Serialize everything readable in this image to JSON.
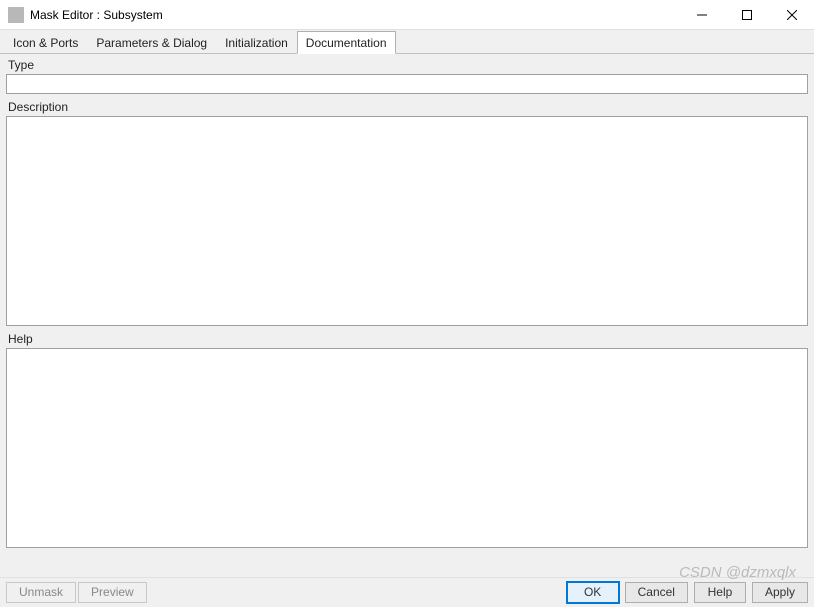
{
  "window": {
    "title": "Mask Editor : Subsystem"
  },
  "tabs": {
    "icon_ports": "Icon & Ports",
    "params_dialog": "Parameters & Dialog",
    "initialization": "Initialization",
    "documentation": "Documentation"
  },
  "fields": {
    "type_label": "Type",
    "type_value": "",
    "description_label": "Description",
    "description_value": "",
    "help_label": "Help",
    "help_value": ""
  },
  "buttons": {
    "unmask": "Unmask",
    "preview": "Preview",
    "ok": "OK",
    "cancel": "Cancel",
    "help": "Help",
    "apply": "Apply"
  },
  "watermark": "CSDN @dzmxqlx"
}
